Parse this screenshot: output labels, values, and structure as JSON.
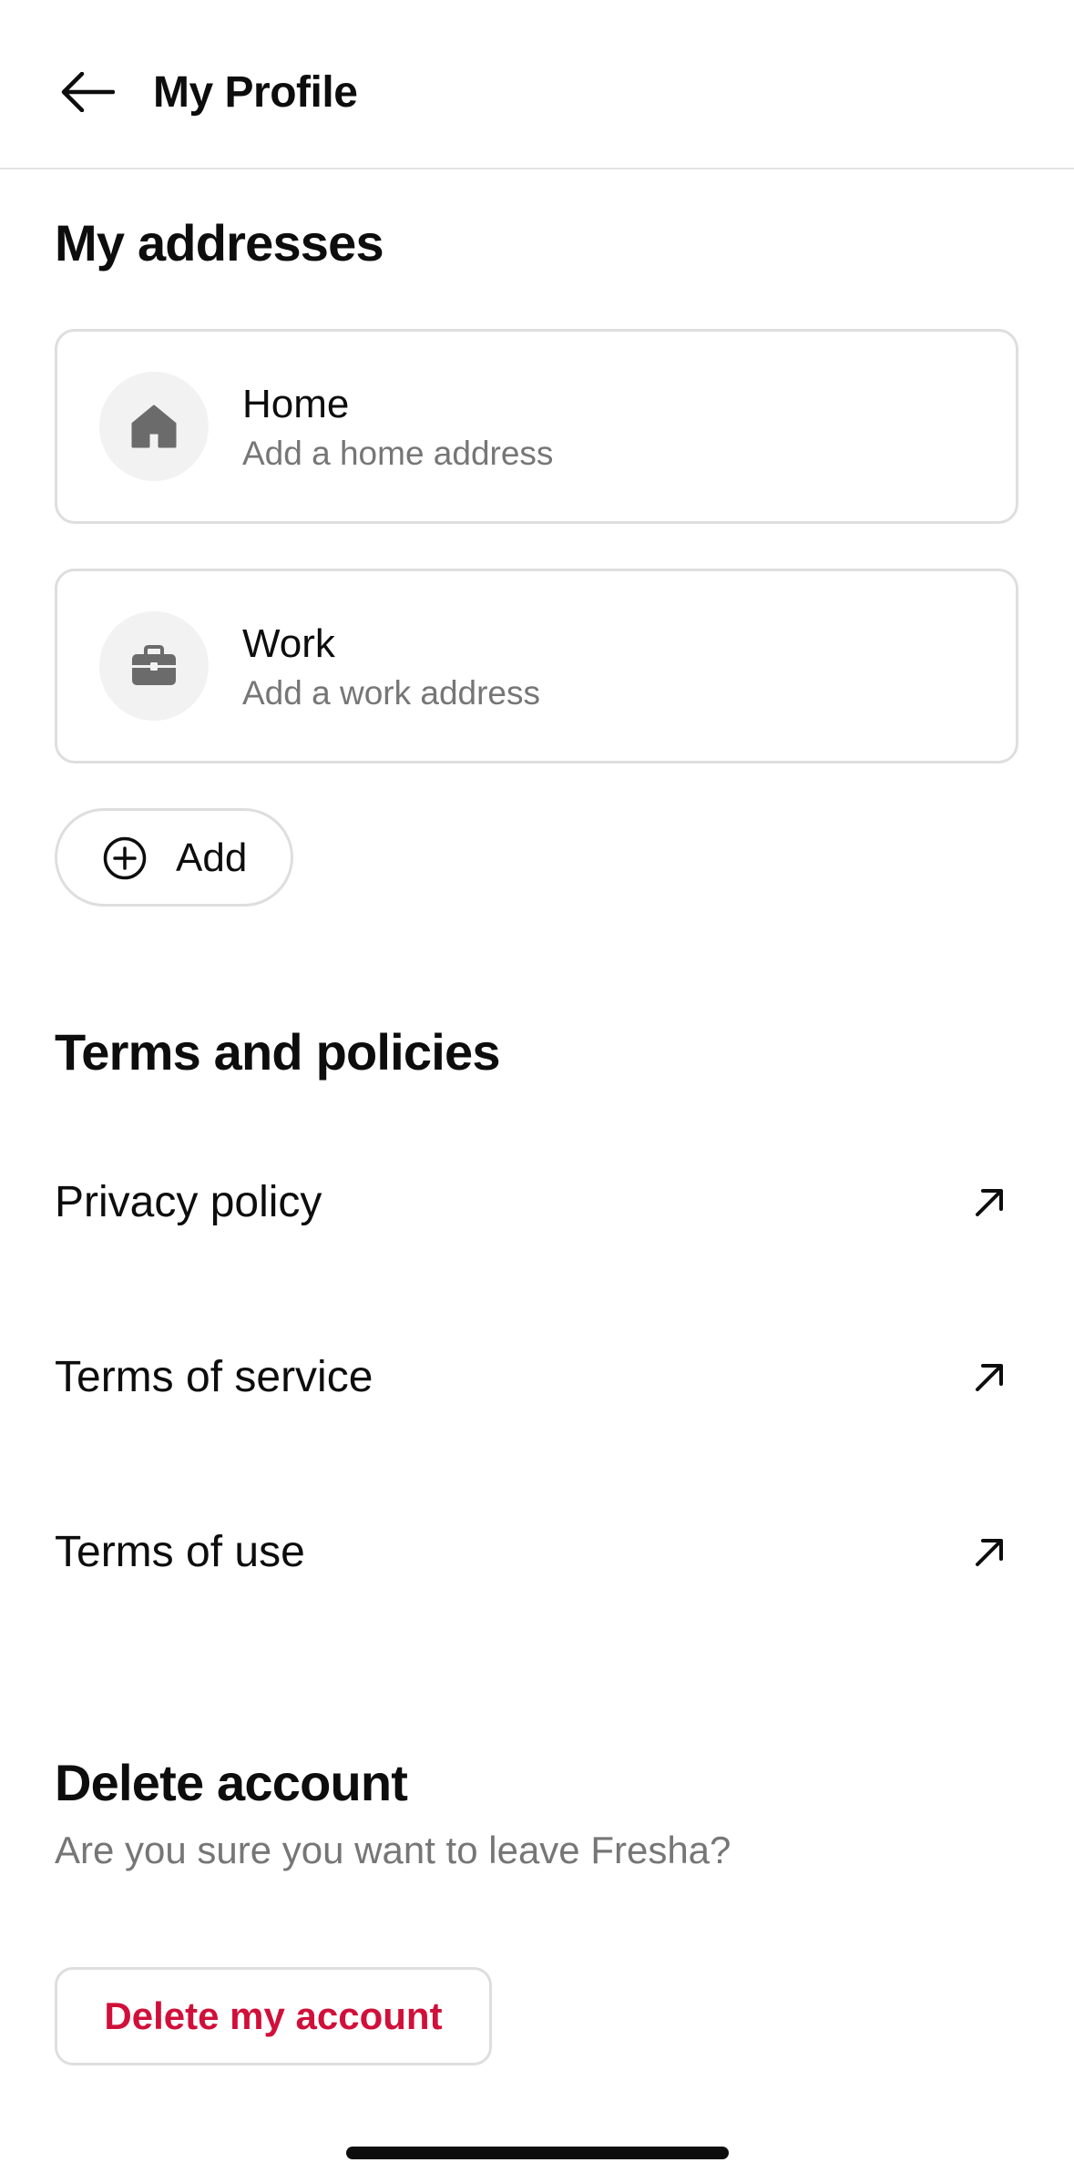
{
  "header": {
    "back_icon": "arrow-left-icon",
    "title": "My Profile"
  },
  "addresses": {
    "heading": "My addresses",
    "items": [
      {
        "icon": "home-icon",
        "title": "Home",
        "subtitle": "Add a home address"
      },
      {
        "icon": "briefcase-icon",
        "title": "Work",
        "subtitle": "Add a work address"
      }
    ],
    "add_icon": "plus-circle-icon",
    "add_label": "Add"
  },
  "policies": {
    "heading": "Terms and policies",
    "items": [
      {
        "label": "Privacy policy",
        "icon": "external-link-arrow-icon"
      },
      {
        "label": "Terms of service",
        "icon": "external-link-arrow-icon"
      },
      {
        "label": "Terms of use",
        "icon": "external-link-arrow-icon"
      }
    ]
  },
  "delete": {
    "heading": "Delete account",
    "subtitle": "Are you sure you want to leave Fresha?",
    "button_label": "Delete my account",
    "button_color": "#d0103a"
  },
  "colors": {
    "text": "#0d0d0d",
    "muted": "#767676",
    "border": "#dedede",
    "icon_bg": "#f2f2f2",
    "icon_fg": "#6b6b6b"
  }
}
